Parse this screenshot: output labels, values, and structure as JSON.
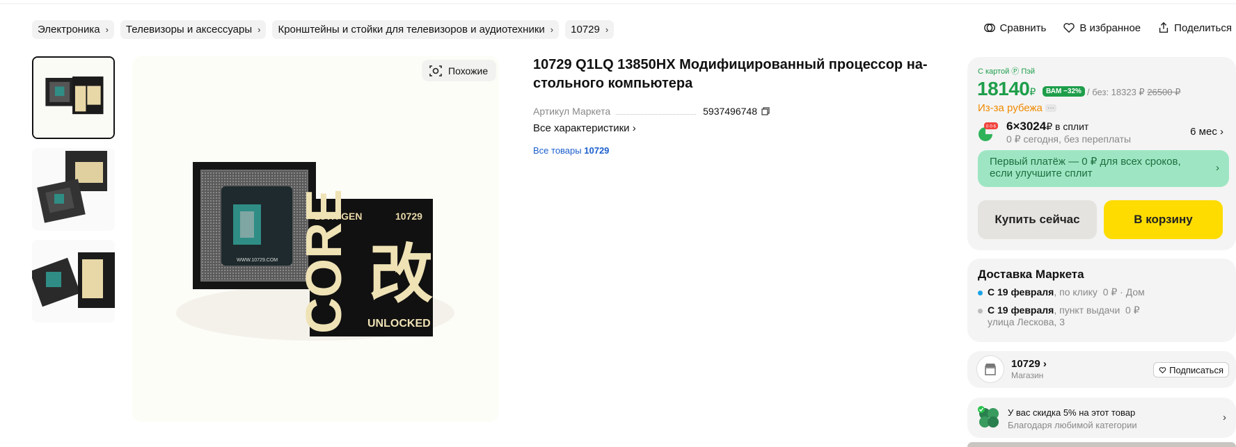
{
  "breadcrumbs": [
    {
      "label": "Электроника"
    },
    {
      "label": "Телевизоры и аксессуары"
    },
    {
      "label": "Кронштейны и стойки для телевизоров и аудиотехники"
    },
    {
      "label": "10729"
    }
  ],
  "header_actions": {
    "compare": "Сравнить",
    "favorite": "В избранное",
    "share": "Поделиться"
  },
  "gallery": {
    "similar_label": "Похожие",
    "main_box": {
      "gen_text": "13TH GEN",
      "model_text": "10729",
      "core_text": "CORE",
      "kanji": "改",
      "unlocked_text": "UNLOCKED",
      "board_text": "WWW.10729.COM"
    }
  },
  "product": {
    "title": "10729 Q1LQ 13850HX Модифицированный процессор на­стольного компьютера",
    "sku_label": "Артикул Маркета",
    "sku_value": "5937496748",
    "all_chars": "Все характеристики",
    "all_goods_prefix": "Все товары",
    "all_goods_brand": "10729"
  },
  "pricing": {
    "pay_label": "С картой Ⓟ Пэй",
    "price": "18140",
    "currency": "₽",
    "discount_badge": "ВАМ −32%",
    "without_card": "/ без: 18323 ₽",
    "old_price": "26500 ₽",
    "abroad": "Из-за рубежа",
    "abroad_more": "···",
    "split_main": "6×3024",
    "split_suffix": "₽ в сплит",
    "split_sub": "0 ₽ сегодня, без переплаты",
    "split_term": "6 мес",
    "split_badge": "0·0·6",
    "first_payment": "Первый платёж — 0 ₽ для всех сроков, если улучшите сплит",
    "buy_now": "Купить сейчас",
    "add_to_cart": "В корзину",
    "colors": {
      "green": "#1e9e4a",
      "orange": "#f08a00",
      "yellow": "#fedc00"
    }
  },
  "delivery": {
    "title": "Доставка Маркета",
    "options": [
      {
        "date": "С 19 февраля",
        "method": ", по клику",
        "price": "0 ₽ · Дом",
        "address": ""
      },
      {
        "date": "С 19 февраля",
        "method": ", пункт выдачи",
        "price": "0 ₽",
        "address": "улица Лескова, 3"
      }
    ]
  },
  "shop": {
    "name": "10729",
    "type": "Магазин",
    "subscribe": "Подписаться"
  },
  "promo": {
    "main": "У вас скидка 5% на этот товар",
    "sub": "Благодаря любимой категории"
  }
}
